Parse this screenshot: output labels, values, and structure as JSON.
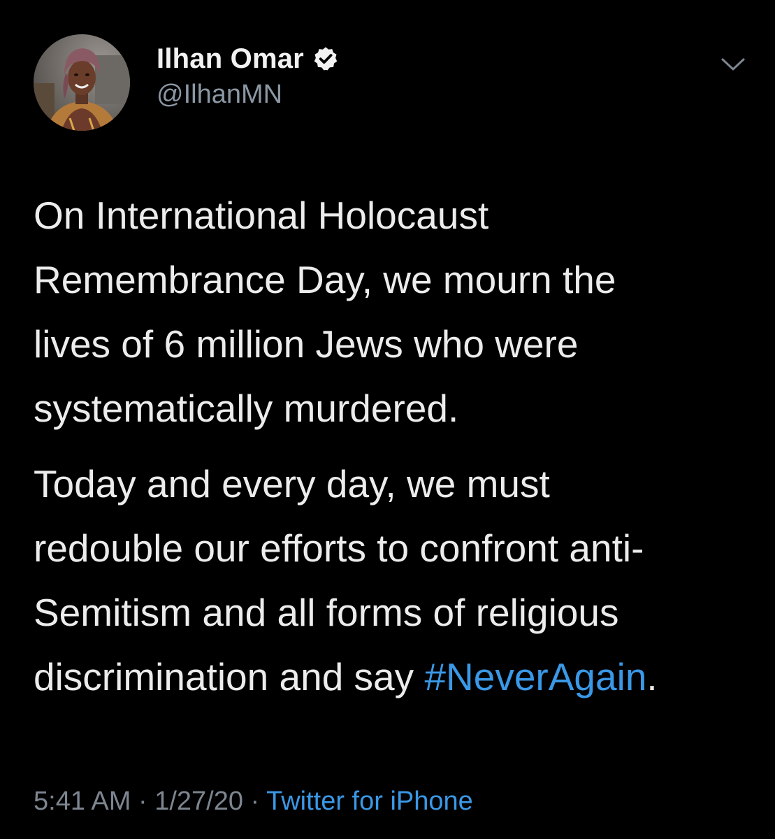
{
  "author": {
    "display_name": "Ilhan Omar",
    "handle": "@IlhanMN",
    "verified": true,
    "verified_icon": "verified-badge-icon"
  },
  "menu": {
    "icon": "chevron-down-icon"
  },
  "tweet": {
    "lines_p1": [
      "On International Holocaust",
      "Remembrance Day, we mourn the",
      "lives of 6 million Jews who were",
      "systematically murdered."
    ],
    "lines_p2": [
      "Today and every day, we must",
      "redouble our efforts to confront anti-",
      "Semitism and all forms of religious"
    ],
    "last_line_prefix": "discrimination and say ",
    "hashtag": "#NeverAgain",
    "last_line_suffix": "."
  },
  "meta": {
    "time": "5:41 AM",
    "sep1": " · ",
    "date": "1/27/20",
    "sep2": " · ",
    "source": "Twitter for iPhone"
  },
  "colors": {
    "background": "#000000",
    "text": "#ececec",
    "secondary": "#8b97a3",
    "link": "#3a98e6"
  }
}
